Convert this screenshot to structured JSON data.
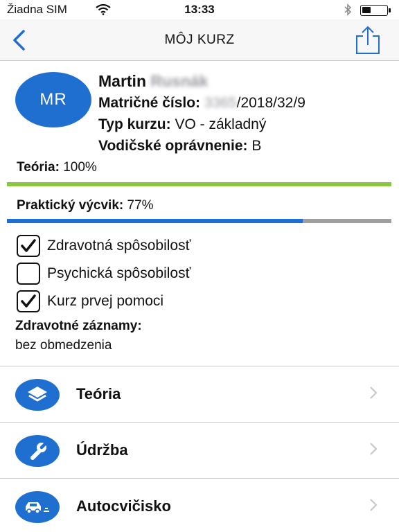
{
  "status": {
    "carrier": "Žiadna SIM",
    "time": "13:33"
  },
  "nav": {
    "title": "MÔJ KURZ",
    "back_icon": "chevron-left-icon",
    "share_icon": "share-icon"
  },
  "profile": {
    "initials": "MR",
    "first_name": "Martin",
    "last_name": "Rusnák",
    "registration_label": "Matričné číslo:",
    "registration_prefix": "3365",
    "registration_suffix": "/2018/32/9",
    "course_type_label": "Typ kurzu:",
    "course_type": "VO - základný",
    "license_label": "Vodičské oprávnenie:",
    "license": "B"
  },
  "progress": {
    "theory_label": "Teória:",
    "theory_value": "100%",
    "theory_fraction": 1.0,
    "practical_label": "Praktický výcvik:",
    "practical_value": "77%",
    "practical_fraction": 0.77
  },
  "checklist": [
    {
      "label": "Zdravotná spôsobilosť",
      "checked": true
    },
    {
      "label": "Psychická spôsobilosť",
      "checked": false
    },
    {
      "label": "Kurz prvej pomoci",
      "checked": true
    }
  ],
  "records": {
    "label": "Zdravotné záznamy:",
    "value": "bez obmedzenia"
  },
  "menu": [
    {
      "label": "Teória",
      "icon": "layers-icon"
    },
    {
      "label": "Údržba",
      "icon": "wrench-icon"
    },
    {
      "label": "Autocvičisko",
      "icon": "car-icon"
    }
  ],
  "colors": {
    "accent": "#1f6fd0",
    "theory_bar": "#8cc63f",
    "practical_bar": "#1f6fd0",
    "track": "#9e9e9e"
  }
}
